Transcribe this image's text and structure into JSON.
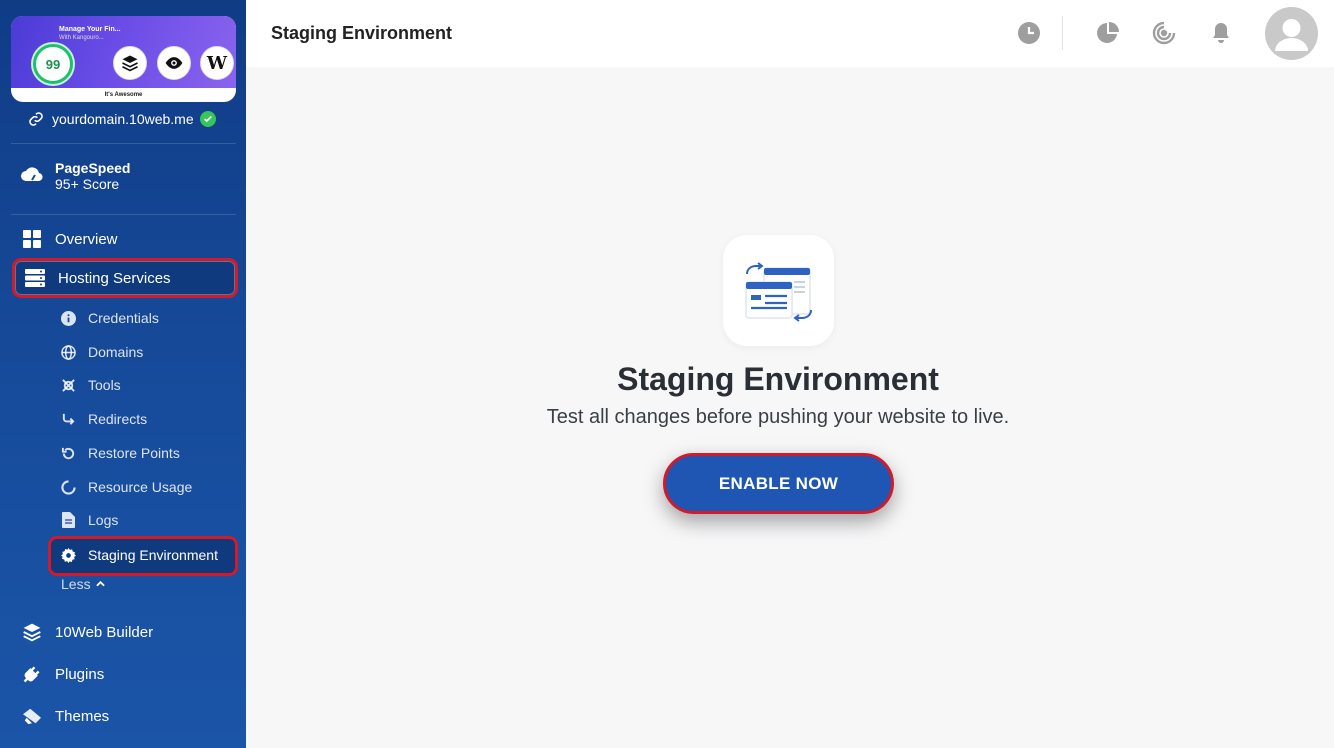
{
  "site": {
    "score": "99",
    "preview_headline": "Manage Your Fin...",
    "preview_subline": "With Kangouro...",
    "preview_caption": "It's Awesome",
    "wp_letter": "W",
    "domain": "yourdomain.10web.me"
  },
  "pagespeed": {
    "title": "PageSpeed",
    "score": "95+ Score"
  },
  "nav": {
    "overview": "Overview",
    "hosting": "Hosting Services",
    "sub": [
      "Credentials",
      "Domains",
      "Tools",
      "Redirects",
      "Restore Points",
      "Resource Usage",
      "Logs",
      "Staging Environment"
    ],
    "less": "Less",
    "builder": "10Web Builder",
    "plugins": "Plugins",
    "themes": "Themes"
  },
  "header": {
    "title": "Staging Environment"
  },
  "main": {
    "title": "Staging Environment",
    "subtitle": "Test all changes before pushing your website to live.",
    "button": "ENABLE NOW"
  },
  "colors": {
    "sidebar": "#174c9c",
    "accent_button": "#1f56b4",
    "highlight": "#d11a2a",
    "success": "#37c45a"
  }
}
